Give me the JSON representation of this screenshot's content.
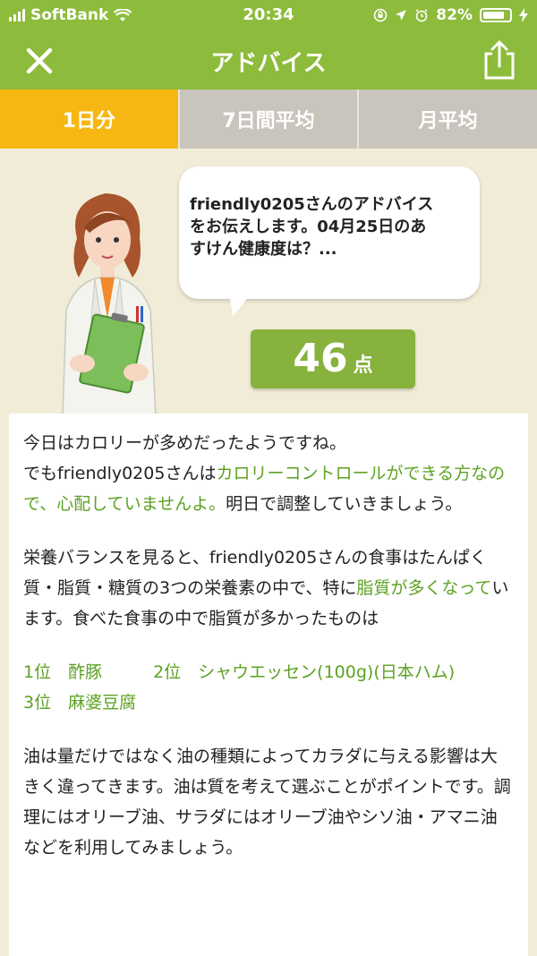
{
  "status": {
    "carrier": "SoftBank",
    "time": "20:34",
    "battery": "82%",
    "battery_level": 0.82
  },
  "nav": {
    "title": "アドバイス"
  },
  "tabs": [
    {
      "label": "1日分"
    },
    {
      "label": "7日間平均"
    },
    {
      "label": "月平均"
    }
  ],
  "bubble": {
    "line1": "friendly0205さんのアドバイス",
    "line2": "をお伝えします。04月25日のあ",
    "line3": "すけん健康度は？..."
  },
  "score": {
    "value": "46",
    "unit": "点"
  },
  "advice": {
    "p1a": "今日はカロリーが多めだったようですね。",
    "p1b": "でもfriendly0205さんは",
    "p1c": "カロリーコントロールができる方なので、心配していませんよ。",
    "p1d": "明日で調整していきましょう。",
    "p2a": "栄養バランスを見ると、friendly0205さんの食事はたんぱく質・脂質・糖質の3つの栄養素の中で、特に",
    "p2b": "脂質が多くなって",
    "p2c": "います。食べた食事の中で脂質が多かったものは",
    "ranking": "1位　酢豚　　　2位　シャウエッセン(100g)(日本ハム)　　　3位　麻婆豆腐",
    "p3": "油は量だけではなく油の種類によってカラダに与える影響は大きく違ってきます。油は質を考えて選ぶことがポイントです。調理にはオリーブ油、サラダにはオリーブ油やシソ油・アマニ油などを利用してみましょう。"
  },
  "colors": {
    "header": "#8dbb3b",
    "active_tab": "#f7b712",
    "inactive_tab": "#c9c4bc",
    "accent_text": "#5da222",
    "score_bg": "#86b23d"
  }
}
